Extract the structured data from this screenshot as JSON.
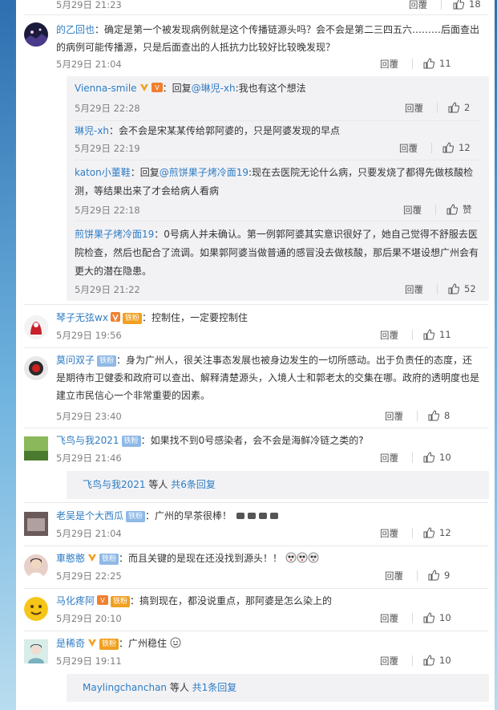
{
  "actions": {
    "reply": "回覆"
  },
  "top_partial": {
    "time": "5月29日 21:23",
    "likes": "18"
  },
  "comments": [
    {
      "user": "的乙回也",
      "text": "：确定是第一个被发现病例就是这个传播链源头吗？会不会是第二三四五六………后面查出的病例可能传播源，只是后面查出的人抵抗力比较好比较晚发现？",
      "time": "5月29日 21:04",
      "likes": "11",
      "subreplies": [
        {
          "user": "Vienna-smile",
          "prefix": "：回复",
          "mention": "@琳児-xh",
          "text": ":我也有这个想法",
          "time": "5月29日 22:28",
          "likes": "2"
        },
        {
          "user": "琳児-xh",
          "prefix": "",
          "mention": "",
          "text": "：会不会是宋某某传给郭阿婆的，只是阿婆发现的早点",
          "time": "5月29日 22:19",
          "likes": "12"
        },
        {
          "user": "katon小董鞋",
          "prefix": "：回复",
          "mention": "@煎饼果子烤冷面19",
          "text": ":现在去医院无论什么病，只要发烧了都得先做核酸检测，等结果出来了才会给病人看病",
          "time": "5月29日 22:18",
          "likes": "赞"
        },
        {
          "user": "煎饼果子烤冷面19",
          "prefix": "",
          "mention": "",
          "text": "：0号病人并未确认。第一例郭阿婆其实意识很好了，她自己觉得不舒服去医院检查，然后也配合了流调。如果郭阿婆当做普通的感冒没去做核酸，那后果不堪设想广州会有更大的潜在隐患。",
          "time": "5月29日 21:22",
          "likes": "52"
        }
      ]
    },
    {
      "user": "琴子无弦wx",
      "badge": "铁粉",
      "text": "：控制住，一定要控制住",
      "time": "5月29日 19:56",
      "likes": "11"
    },
    {
      "user": "莫问双子",
      "badge": "铁粉",
      "text": "：身为广州人，很关注事态发展也被身边发生的一切所感动。出于负责任的态度，还是期待市卫健委和政府可以查出、解释清楚源头，入境人士和郭老太的交集在哪。政府的透明度也是建立市民信心一个非常重要的因素。",
      "time": "5月29日 23:40",
      "likes": "8"
    },
    {
      "user": "飞鸟与我2021",
      "badge": "铁粉",
      "text": "：如果找不到0号感染者，会不会是海鲜冷链之类的?",
      "time": "5月29日 21:46",
      "likes": "10",
      "more": {
        "user": "飞鸟与我2021",
        "middle": " 等人 ",
        "count": "共6条回复"
      }
    },
    {
      "user": "老吴是个大西瓜",
      "badge": "铁粉",
      "text": "：广州的早茶很棒！",
      "time": "5月29日 21:04",
      "likes": "12"
    },
    {
      "user": "車憨憨",
      "badge": "铁粉",
      "text": "：而且关键的是现在还没找到源头！！",
      "time": "5月29日 22:25",
      "likes": "9"
    },
    {
      "user": "马化疼阿",
      "badge": "铁粉",
      "text": "：搞到现在，都没说重点，那阿婆是怎么染上的",
      "time": "5月29日 20:10",
      "likes": "10"
    },
    {
      "user": "是稀奇",
      "badge": "铁粉",
      "text": "：广州稳住",
      "time": "5月29日 19:11",
      "likes": "10",
      "more": {
        "user": "Maylingchanchan",
        "middle": " 等人 ",
        "count": "共1条回复"
      }
    }
  ],
  "colors": {
    "link": "#2e7cc2",
    "panel": "#f2f2f5",
    "badge_orange": "#f0a020"
  }
}
